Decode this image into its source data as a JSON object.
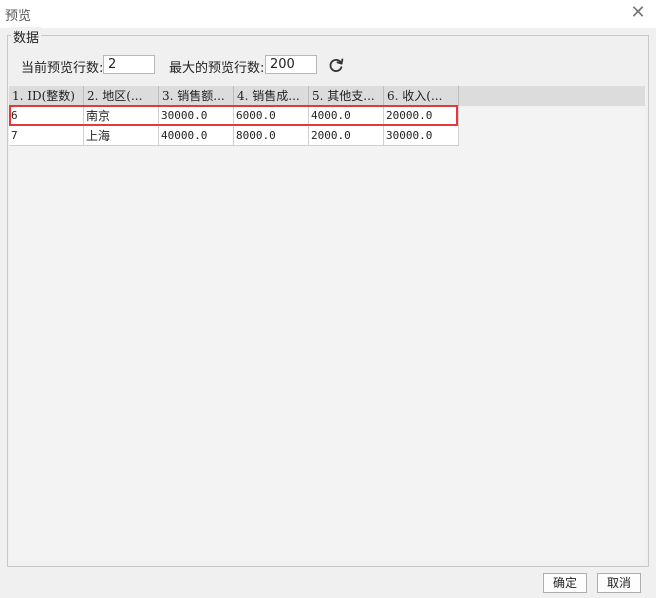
{
  "window": {
    "title": "预览",
    "close_symbol": "✕"
  },
  "group": {
    "title": "数据"
  },
  "controls": {
    "current_rows_label": "当前预览行数:",
    "current_rows_value": "2",
    "max_rows_label": "最大的预览行数:",
    "max_rows_value": "200"
  },
  "table": {
    "headers": [
      "1. ID(整数)",
      "2. 地区(...",
      "3. 销售额...",
      "4. 销售成...",
      "5. 其他支...",
      "6. 收入(..."
    ],
    "rows": [
      [
        "6",
        "南京",
        "30000.0",
        "6000.0",
        "4000.0",
        "20000.0"
      ],
      [
        "7",
        "上海",
        "40000.0",
        "8000.0",
        "2000.0",
        "30000.0"
      ]
    ],
    "highlight_color": "#e23a3a"
  },
  "buttons": {
    "ok": "确定",
    "cancel": "取消"
  },
  "icons": {
    "refresh": "refresh-icon",
    "close": "close-icon"
  }
}
